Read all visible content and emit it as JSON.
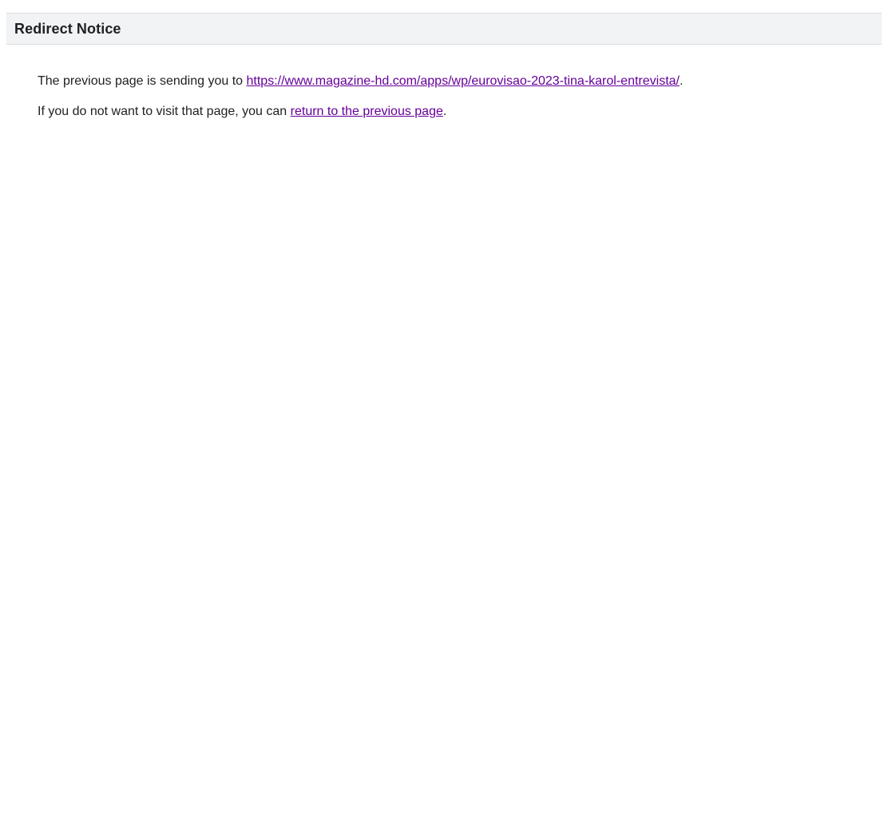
{
  "header": {
    "title": "Redirect Notice"
  },
  "content": {
    "line1": {
      "prefix": "The previous page is sending you to ",
      "link_text": "https://www.magazine-hd.com/apps/wp/eurovisao-2023-tina-karol-entrevista/",
      "suffix": "."
    },
    "line2": {
      "prefix": "If you do not want to visit that page, you can ",
      "link_text": "return to the previous page",
      "suffix": "."
    }
  },
  "colors": {
    "header_background": "#f1f3f4",
    "header_border": "#dadce0",
    "text": "#202124",
    "link_visited": "#660099",
    "page_background": "#ffffff"
  }
}
